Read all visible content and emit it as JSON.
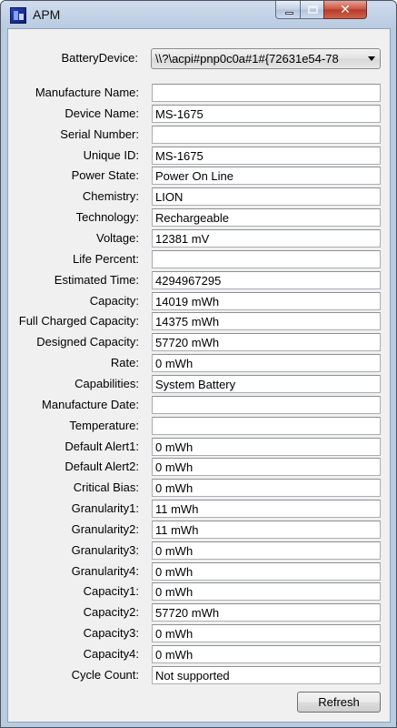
{
  "window": {
    "title": "APM",
    "close_symbol": "✕"
  },
  "battery_device": {
    "label": "BatteryDevice:",
    "value": "\\\\?\\acpi#pnp0c0a#1#{72631e54-78"
  },
  "fields": [
    {
      "label": "Manufacture Name:",
      "value": ""
    },
    {
      "label": "Device Name:",
      "value": "MS-1675"
    },
    {
      "label": "Serial Number:",
      "value": ""
    },
    {
      "label": "Unique ID:",
      "value": "MS-1675"
    },
    {
      "label": "Power State:",
      "value": "Power On Line"
    },
    {
      "label": "Chemistry:",
      "value": "LION"
    },
    {
      "label": "Technology:",
      "value": "Rechargeable"
    },
    {
      "label": "Voltage:",
      "value": "12381 mV"
    },
    {
      "label": "Life Percent:",
      "value": ""
    },
    {
      "label": "Estimated Time:",
      "value": "4294967295"
    },
    {
      "label": "Capacity:",
      "value": "14019 mWh"
    },
    {
      "label": "Full Charged Capacity:",
      "value": "14375 mWh"
    },
    {
      "label": "Designed Capacity:",
      "value": "57720 mWh"
    },
    {
      "label": "Rate:",
      "value": "0 mWh"
    },
    {
      "label": "Capabilities:",
      "value": "System Battery"
    },
    {
      "label": "Manufacture Date:",
      "value": ""
    },
    {
      "label": "Temperature:",
      "value": ""
    },
    {
      "label": "Default Alert1:",
      "value": "0 mWh"
    },
    {
      "label": "Default Alert2:",
      "value": "0 mWh"
    },
    {
      "label": "Critical Bias:",
      "value": "0 mWh"
    },
    {
      "label": "Granularity1:",
      "value": "11 mWh"
    },
    {
      "label": "Granularity2:",
      "value": "11 mWh"
    },
    {
      "label": "Granularity3:",
      "value": "0 mWh"
    },
    {
      "label": "Granularity4:",
      "value": "0 mWh"
    },
    {
      "label": "Capacity1:",
      "value": "0 mWh"
    },
    {
      "label": "Capacity2:",
      "value": "57720 mWh"
    },
    {
      "label": "Capacity3:",
      "value": "0 mWh"
    },
    {
      "label": "Capacity4:",
      "value": "0 mWh"
    },
    {
      "label": "Cycle Count:",
      "value": "Not supported"
    }
  ],
  "buttons": {
    "refresh": "Refresh"
  }
}
